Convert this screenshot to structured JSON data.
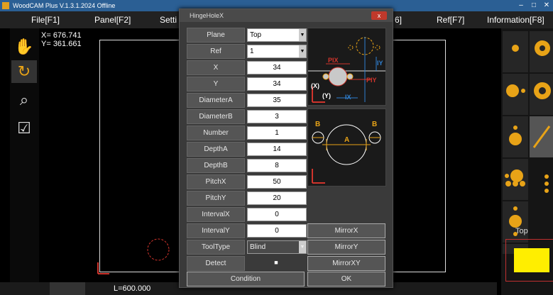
{
  "app": {
    "title": "WoodCAM Plus V.1.3.1.2024 Offline"
  },
  "menu": {
    "file": "File[F1]",
    "panel": "Panel[F2]",
    "setting": "Setti",
    "f6": "6]",
    "ref": "Ref[F7]",
    "info": "Information[F8]"
  },
  "coords": {
    "x": "X= 676.741",
    "y": "Y= 361.661"
  },
  "status": {
    "length": "L=600.000"
  },
  "right_panel": {
    "top_label": "Top"
  },
  "dialog": {
    "title": "HingeHoleX",
    "close": "x",
    "params": [
      {
        "label": "Plane",
        "value": "Top",
        "kind": "select"
      },
      {
        "label": "Ref",
        "value": "1",
        "kind": "select"
      },
      {
        "label": "X",
        "value": "34",
        "kind": "input"
      },
      {
        "label": "Y",
        "value": "34",
        "kind": "input"
      },
      {
        "label": "DiameterA",
        "value": "35",
        "kind": "input"
      },
      {
        "label": "DiameterB",
        "value": "3",
        "kind": "input"
      },
      {
        "label": "Number",
        "value": "1",
        "kind": "input"
      },
      {
        "label": "DepthA",
        "value": "14",
        "kind": "input"
      },
      {
        "label": "DepthB",
        "value": "8",
        "kind": "input"
      },
      {
        "label": "PitchX",
        "value": "50",
        "kind": "input"
      },
      {
        "label": "PitchY",
        "value": "20",
        "kind": "input"
      },
      {
        "label": "IntervalX",
        "value": "0",
        "kind": "input"
      },
      {
        "label": "IntervalY",
        "value": "0",
        "kind": "input"
      },
      {
        "label": "ToolType",
        "value": "Blind",
        "kind": "select"
      },
      {
        "label": "Detect",
        "value": "■",
        "kind": "check"
      }
    ],
    "buttons": {
      "mirror_x": "MirrorX",
      "mirror_y": "MirrorY",
      "mirror_xy": "MirrorXY",
      "condition": "Condition",
      "ok": "OK"
    },
    "preview1": {
      "pix": "PIX",
      "piy": "PIY",
      "iy": "IY",
      "ix": "IX",
      "x": "(X)",
      "y": "(Y)"
    },
    "preview2": {
      "a": "A",
      "b_left": "B",
      "b_right": "B"
    }
  },
  "colors": {
    "accent": "#e8a317",
    "red": "#d0342c",
    "blue": "#2f7fd0"
  }
}
